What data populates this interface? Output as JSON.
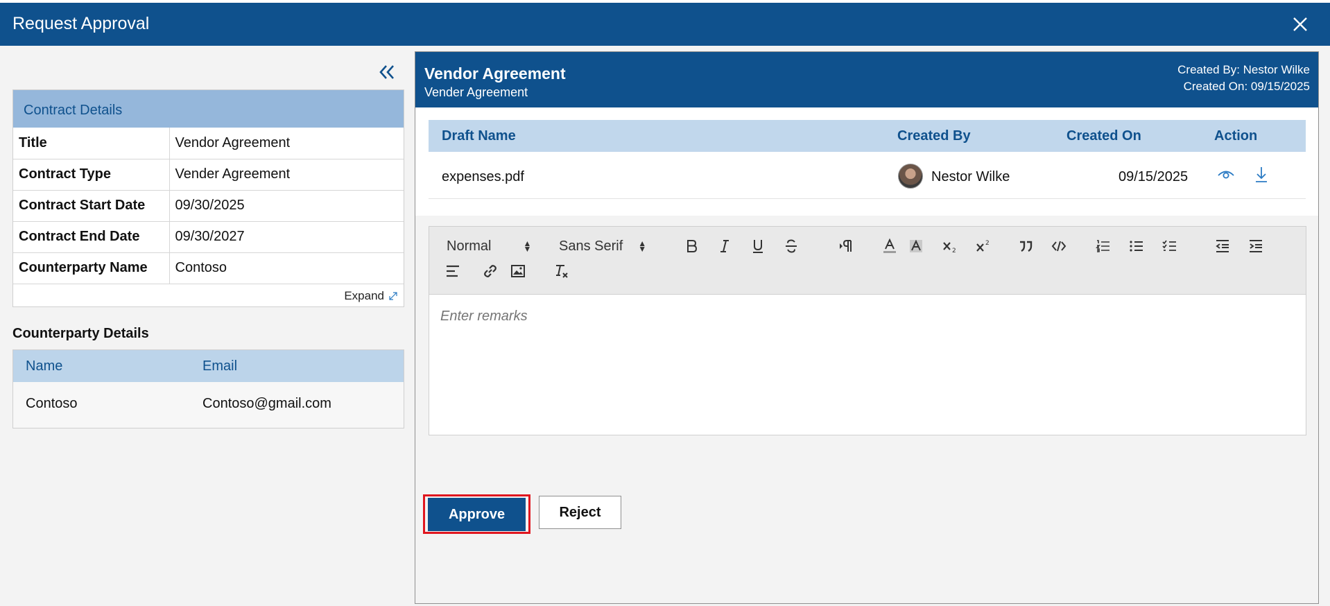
{
  "dialog": {
    "title": "Request Approval"
  },
  "contract_details": {
    "header": "Contract Details",
    "rows": [
      {
        "label": "Title",
        "value": "Vendor Agreement"
      },
      {
        "label": "Contract Type",
        "value": "Vender Agreement"
      },
      {
        "label": "Contract Start Date",
        "value": "09/30/2025"
      },
      {
        "label": "Contract End Date",
        "value": "09/30/2027"
      },
      {
        "label": "Counterparty Name",
        "value": "Contoso"
      }
    ],
    "expand_label": "Expand"
  },
  "counterparty": {
    "title": "Counterparty Details",
    "columns": [
      "Name",
      "Email"
    ],
    "rows": [
      {
        "name": "Contoso",
        "email": "Contoso@gmail.com"
      }
    ]
  },
  "panel": {
    "name": "Vendor Agreement",
    "type": "Vender Agreement",
    "created_by": "Created By: Nestor Wilke",
    "created_on": "Created On: 09/15/2025"
  },
  "drafts": {
    "columns": [
      "Draft Name",
      "Created By",
      "Created On",
      "Action"
    ],
    "rows": [
      {
        "name": "expenses.pdf",
        "created_by": "Nestor Wilke",
        "created_on": "09/15/2025"
      }
    ]
  },
  "editor": {
    "format": "Normal",
    "font": "Sans Serif",
    "placeholder": "Enter remarks"
  },
  "actions": {
    "approve": "Approve",
    "reject": "Reject"
  },
  "colors": {
    "primary": "#0f518d",
    "header_light": "#95b7db",
    "row_head": "#bcd4ea",
    "highlight": "#e0161f"
  }
}
